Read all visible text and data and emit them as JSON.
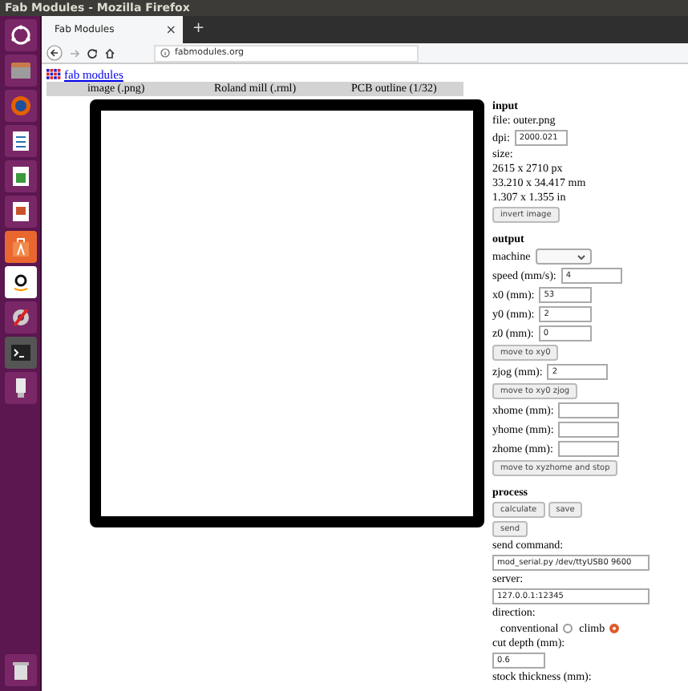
{
  "window": {
    "title": "Fab Modules - Mozilla Firefox"
  },
  "tabs": [
    {
      "label": "Fab Modules",
      "selected": true,
      "close": "×"
    }
  ],
  "new_tab": "+",
  "address_bar": {
    "url": "fabmodules.org"
  },
  "page": {
    "logo_link": "fab modules",
    "header": [
      "image (.png)",
      "Roland mill (.rml)",
      "PCB outline (1/32)"
    ],
    "panel": [
      {
        "kind": "heading",
        "text": "input"
      },
      {
        "kind": "text",
        "text": "file: outer.png"
      },
      {
        "kind": "field",
        "label": "dpi:",
        "value": "2000.021"
      },
      {
        "kind": "text",
        "text": "size:"
      },
      {
        "kind": "text",
        "text": "2615 x 2710 px"
      },
      {
        "kind": "text",
        "text": "33.210 x 34.417 mm"
      },
      {
        "kind": "text",
        "text": "1.307 x 1.355 in"
      },
      {
        "kind": "buttons",
        "buttons": [
          "invert image"
        ]
      },
      {
        "kind": "heading",
        "text": "output"
      },
      {
        "kind": "select",
        "label": "machine"
      },
      {
        "kind": "field",
        "label": "speed (mm/s):",
        "value": "4"
      },
      {
        "kind": "field",
        "label": "x0 (mm):",
        "value": "53"
      },
      {
        "kind": "field",
        "label": "y0 (mm):",
        "value": "2"
      },
      {
        "kind": "field",
        "label": "z0 (mm):",
        "value": "0"
      },
      {
        "kind": "buttons",
        "buttons": [
          "move to xy0"
        ]
      },
      {
        "kind": "field",
        "label": "zjog (mm):",
        "value": "2"
      },
      {
        "kind": "buttons",
        "buttons": [
          "move to xy0 zjog"
        ]
      },
      {
        "kind": "field",
        "label": "xhome (mm):"
      },
      {
        "kind": "field",
        "label": "yhome (mm):"
      },
      {
        "kind": "field",
        "label": "zhome (mm):"
      },
      {
        "kind": "buttons",
        "buttons": [
          "move to xyzhome and stop"
        ]
      },
      {
        "kind": "heading",
        "text": "process"
      },
      {
        "kind": "buttons",
        "buttons": [
          "calculate",
          "save",
          "send"
        ]
      },
      {
        "kind": "text",
        "text": "send command:"
      },
      {
        "kind": "wide_field",
        "value": "mod_serial.py /dev/ttyUSB0 9600"
      },
      {
        "kind": "text",
        "text": "server:"
      },
      {
        "kind": "wide_field",
        "value": "127.0.0.1:12345"
      },
      {
        "kind": "text",
        "text": "direction:"
      },
      {
        "kind": "radios",
        "options": [
          {
            "label": "conventional",
            "selected": false
          },
          {
            "label": "climb",
            "selected": true
          }
        ]
      },
      {
        "kind": "text",
        "text": "cut depth (mm):"
      },
      {
        "kind": "field_only",
        "value": "0.6"
      },
      {
        "kind": "text",
        "text": "stock thickness (mm):"
      }
    ]
  }
}
